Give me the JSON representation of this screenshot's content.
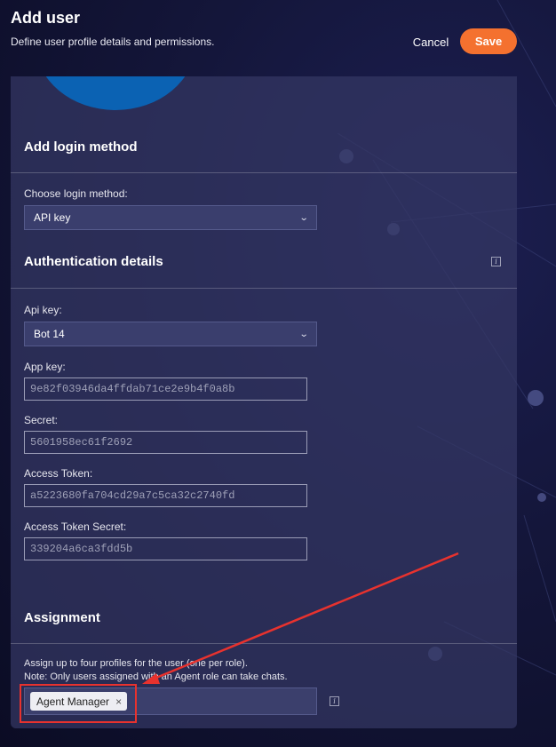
{
  "header": {
    "title": "Add user",
    "subtitle": "Define user profile details and permissions.",
    "cancel_label": "Cancel",
    "save_label": "Save"
  },
  "login_section": {
    "title": "Add login method",
    "choose_label": "Choose login method:",
    "selected_method": "API key"
  },
  "auth_section": {
    "title": "Authentication details",
    "info_icon": "info-icon",
    "api_key_label": "Api key:",
    "api_key_value": "Bot 14",
    "app_key_label": "App key:",
    "app_key_value": "9e82f03946da4ffdab71ce2e9b4f0a8b",
    "secret_label": "Secret:",
    "secret_value": "5601958ec61f2692",
    "access_token_label": "Access Token:",
    "access_token_value": "a5223680fa704cd29a7c5ca32c2740fd",
    "access_token_secret_label": "Access Token Secret:",
    "access_token_secret_value": "339204a6ca3fdd5b"
  },
  "assignment_section": {
    "title": "Assignment",
    "note_line1": "Assign up to four profiles for the user (one per role).",
    "note_line2": "Note: Only users assigned with an Agent role can take chats.",
    "profiles": [
      "Agent Manager"
    ],
    "remove_glyph": "×"
  },
  "colors": {
    "accent": "#f4712f",
    "annotation": "#e8322e",
    "avatar": "#0b62b3"
  }
}
